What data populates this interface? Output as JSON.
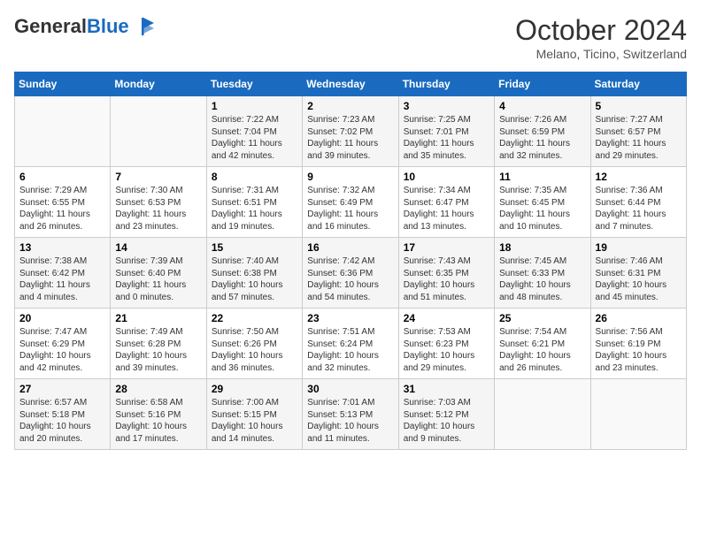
{
  "header": {
    "logo_general": "General",
    "logo_blue": "Blue",
    "month_title": "October 2024",
    "subtitle": "Melano, Ticino, Switzerland"
  },
  "days_of_week": [
    "Sunday",
    "Monday",
    "Tuesday",
    "Wednesday",
    "Thursday",
    "Friday",
    "Saturday"
  ],
  "weeks": [
    [
      {
        "day": "",
        "content": ""
      },
      {
        "day": "",
        "content": ""
      },
      {
        "day": "1",
        "content": "Sunrise: 7:22 AM\nSunset: 7:04 PM\nDaylight: 11 hours and 42 minutes."
      },
      {
        "day": "2",
        "content": "Sunrise: 7:23 AM\nSunset: 7:02 PM\nDaylight: 11 hours and 39 minutes."
      },
      {
        "day": "3",
        "content": "Sunrise: 7:25 AM\nSunset: 7:01 PM\nDaylight: 11 hours and 35 minutes."
      },
      {
        "day": "4",
        "content": "Sunrise: 7:26 AM\nSunset: 6:59 PM\nDaylight: 11 hours and 32 minutes."
      },
      {
        "day": "5",
        "content": "Sunrise: 7:27 AM\nSunset: 6:57 PM\nDaylight: 11 hours and 29 minutes."
      }
    ],
    [
      {
        "day": "6",
        "content": "Sunrise: 7:29 AM\nSunset: 6:55 PM\nDaylight: 11 hours and 26 minutes."
      },
      {
        "day": "7",
        "content": "Sunrise: 7:30 AM\nSunset: 6:53 PM\nDaylight: 11 hours and 23 minutes."
      },
      {
        "day": "8",
        "content": "Sunrise: 7:31 AM\nSunset: 6:51 PM\nDaylight: 11 hours and 19 minutes."
      },
      {
        "day": "9",
        "content": "Sunrise: 7:32 AM\nSunset: 6:49 PM\nDaylight: 11 hours and 16 minutes."
      },
      {
        "day": "10",
        "content": "Sunrise: 7:34 AM\nSunset: 6:47 PM\nDaylight: 11 hours and 13 minutes."
      },
      {
        "day": "11",
        "content": "Sunrise: 7:35 AM\nSunset: 6:45 PM\nDaylight: 11 hours and 10 minutes."
      },
      {
        "day": "12",
        "content": "Sunrise: 7:36 AM\nSunset: 6:44 PM\nDaylight: 11 hours and 7 minutes."
      }
    ],
    [
      {
        "day": "13",
        "content": "Sunrise: 7:38 AM\nSunset: 6:42 PM\nDaylight: 11 hours and 4 minutes."
      },
      {
        "day": "14",
        "content": "Sunrise: 7:39 AM\nSunset: 6:40 PM\nDaylight: 11 hours and 0 minutes."
      },
      {
        "day": "15",
        "content": "Sunrise: 7:40 AM\nSunset: 6:38 PM\nDaylight: 10 hours and 57 minutes."
      },
      {
        "day": "16",
        "content": "Sunrise: 7:42 AM\nSunset: 6:36 PM\nDaylight: 10 hours and 54 minutes."
      },
      {
        "day": "17",
        "content": "Sunrise: 7:43 AM\nSunset: 6:35 PM\nDaylight: 10 hours and 51 minutes."
      },
      {
        "day": "18",
        "content": "Sunrise: 7:45 AM\nSunset: 6:33 PM\nDaylight: 10 hours and 48 minutes."
      },
      {
        "day": "19",
        "content": "Sunrise: 7:46 AM\nSunset: 6:31 PM\nDaylight: 10 hours and 45 minutes."
      }
    ],
    [
      {
        "day": "20",
        "content": "Sunrise: 7:47 AM\nSunset: 6:29 PM\nDaylight: 10 hours and 42 minutes."
      },
      {
        "day": "21",
        "content": "Sunrise: 7:49 AM\nSunset: 6:28 PM\nDaylight: 10 hours and 39 minutes."
      },
      {
        "day": "22",
        "content": "Sunrise: 7:50 AM\nSunset: 6:26 PM\nDaylight: 10 hours and 36 minutes."
      },
      {
        "day": "23",
        "content": "Sunrise: 7:51 AM\nSunset: 6:24 PM\nDaylight: 10 hours and 32 minutes."
      },
      {
        "day": "24",
        "content": "Sunrise: 7:53 AM\nSunset: 6:23 PM\nDaylight: 10 hours and 29 minutes."
      },
      {
        "day": "25",
        "content": "Sunrise: 7:54 AM\nSunset: 6:21 PM\nDaylight: 10 hours and 26 minutes."
      },
      {
        "day": "26",
        "content": "Sunrise: 7:56 AM\nSunset: 6:19 PM\nDaylight: 10 hours and 23 minutes."
      }
    ],
    [
      {
        "day": "27",
        "content": "Sunrise: 6:57 AM\nSunset: 5:18 PM\nDaylight: 10 hours and 20 minutes."
      },
      {
        "day": "28",
        "content": "Sunrise: 6:58 AM\nSunset: 5:16 PM\nDaylight: 10 hours and 17 minutes."
      },
      {
        "day": "29",
        "content": "Sunrise: 7:00 AM\nSunset: 5:15 PM\nDaylight: 10 hours and 14 minutes."
      },
      {
        "day": "30",
        "content": "Sunrise: 7:01 AM\nSunset: 5:13 PM\nDaylight: 10 hours and 11 minutes."
      },
      {
        "day": "31",
        "content": "Sunrise: 7:03 AM\nSunset: 5:12 PM\nDaylight: 10 hours and 9 minutes."
      },
      {
        "day": "",
        "content": ""
      },
      {
        "day": "",
        "content": ""
      }
    ]
  ]
}
